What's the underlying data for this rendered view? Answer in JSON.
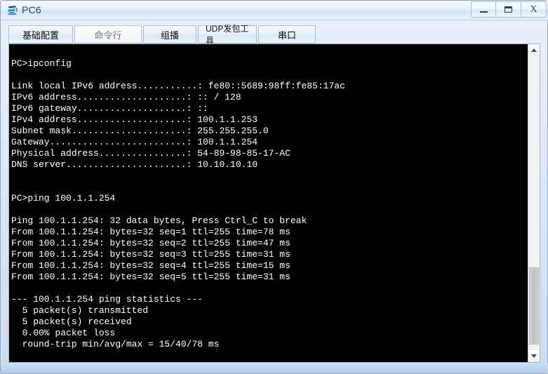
{
  "window": {
    "title": "PC6",
    "icon": "pc-device-icon",
    "controls": [
      {
        "name": "minimize",
        "label": "—"
      },
      {
        "name": "maximize",
        "label": "▭"
      },
      {
        "name": "close",
        "label": "X"
      }
    ]
  },
  "tabs": [
    {
      "label": "基础配置",
      "selected": false
    },
    {
      "label": "命令行",
      "selected": true
    },
    {
      "label": "组播",
      "selected": false
    },
    {
      "label": "UDP发包工具",
      "selected": false
    },
    {
      "label": "串口",
      "selected": false
    }
  ],
  "terminal": {
    "lines": [
      "",
      "PC>ipconfig",
      "",
      "Link local IPv6 address...........: fe80::5689:98ff:fe85:17ac",
      "IPv6 address....................: :: / 128",
      "IPv6 gateway....................: ::",
      "IPv4 address....................: 100.1.1.253",
      "Subnet mask.....................: 255.255.255.0",
      "Gateway.........................: 100.1.1.254",
      "Physical address................: 54-89-98-85-17-AC",
      "DNS server......................: 10.10.10.10",
      "",
      "",
      "PC>ping 100.1.1.254",
      "",
      "Ping 100.1.1.254: 32 data bytes, Press Ctrl_C to break",
      "From 100.1.1.254: bytes=32 seq=1 ttl=255 time=78 ms",
      "From 100.1.1.254: bytes=32 seq=2 ttl=255 time=47 ms",
      "From 100.1.1.254: bytes=32 seq=3 ttl=255 time=31 ms",
      "From 100.1.1.254: bytes=32 seq=4 ttl=255 time=15 ms",
      "From 100.1.1.254: bytes=32 seq=5 ttl=255 time=31 ms",
      "",
      "--- 100.1.1.254 ping statistics ---",
      "  5 packet(s) transmitted",
      "  5 packet(s) received",
      "  0.00% packet loss",
      "  round-trip min/avg/max = 15/40/78 ms"
    ],
    "background_color": "#000000",
    "text_color": "#ffffff"
  },
  "scrollbar": {
    "up_arrow": "▲",
    "down_arrow": "▼",
    "thumb_position": "near-bottom"
  },
  "colors": {
    "title_text": "#16437e",
    "frame": "#8fa7c4",
    "tab_border": "#a9bfd6"
  }
}
